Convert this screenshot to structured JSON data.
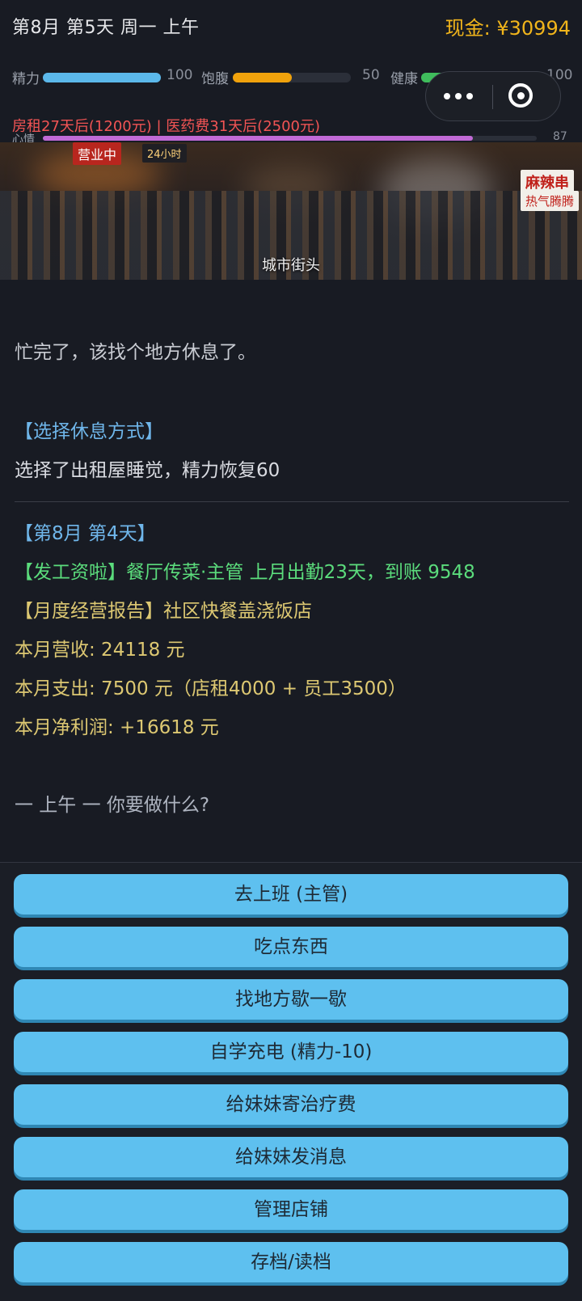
{
  "header": {
    "date": "第8月  第5天  周一  上午",
    "cash": "现金: ¥30994"
  },
  "stats": [
    {
      "label": "精力",
      "value": "100",
      "fraction": 1.0,
      "color": "#5bb8ea"
    },
    {
      "label": "饱腹",
      "value": "50",
      "fraction": 0.5,
      "color": "#f0a20c"
    },
    {
      "label": "健康",
      "value": "100",
      "fraction": 1.0,
      "color": "#3fbd5c"
    }
  ],
  "mood": {
    "label": "心情",
    "value": "87",
    "fraction": 0.87,
    "color": "#c16ad6"
  },
  "warning": "房租27天后(1200元)  |  医药费31天后(2500元)",
  "scene": {
    "caption": "城市街头",
    "signs": [
      "营业中",
      "24小时",
      "麻辣串",
      "热气腾腾"
    ]
  },
  "story": [
    {
      "text": "忙完了，该找个地方休息了。",
      "color": "#c9ccd3"
    },
    {
      "text": "【选择休息方式】",
      "color": "#6fb6ea"
    },
    {
      "text": "选择了出租屋睡觉，精力恢复60",
      "color": "#d9dbe1"
    },
    {
      "text": "【第8月  第4天】",
      "color": "#6fb6ea"
    },
    {
      "text": "【发工资啦】餐厅传菜·主管 上月出勤23天，到账 9548",
      "color": "#5bdc7c"
    },
    {
      "text": "【月度经营报告】社区快餐盖浇饭店",
      "color": "#ddc872"
    },
    {
      "text": "本月营收: 24118 元",
      "color": "#ddc872"
    },
    {
      "text": "本月支出: 7500 元（店租4000 + 员工3500）",
      "color": "#ddc872"
    },
    {
      "text": "本月净利润: +16618 元",
      "color": "#ddc872"
    },
    {
      "text": "一 上午 一  你要做什么?",
      "color": "#aeb4c0"
    }
  ],
  "choices": [
    "去上班 (主管)",
    "吃点东西",
    "找地方歇一歇",
    "自学充电 (精力-10)",
    "给妹妹寄治疗费",
    "给妹妹发消息",
    "管理店铺",
    "存档/读档"
  ]
}
